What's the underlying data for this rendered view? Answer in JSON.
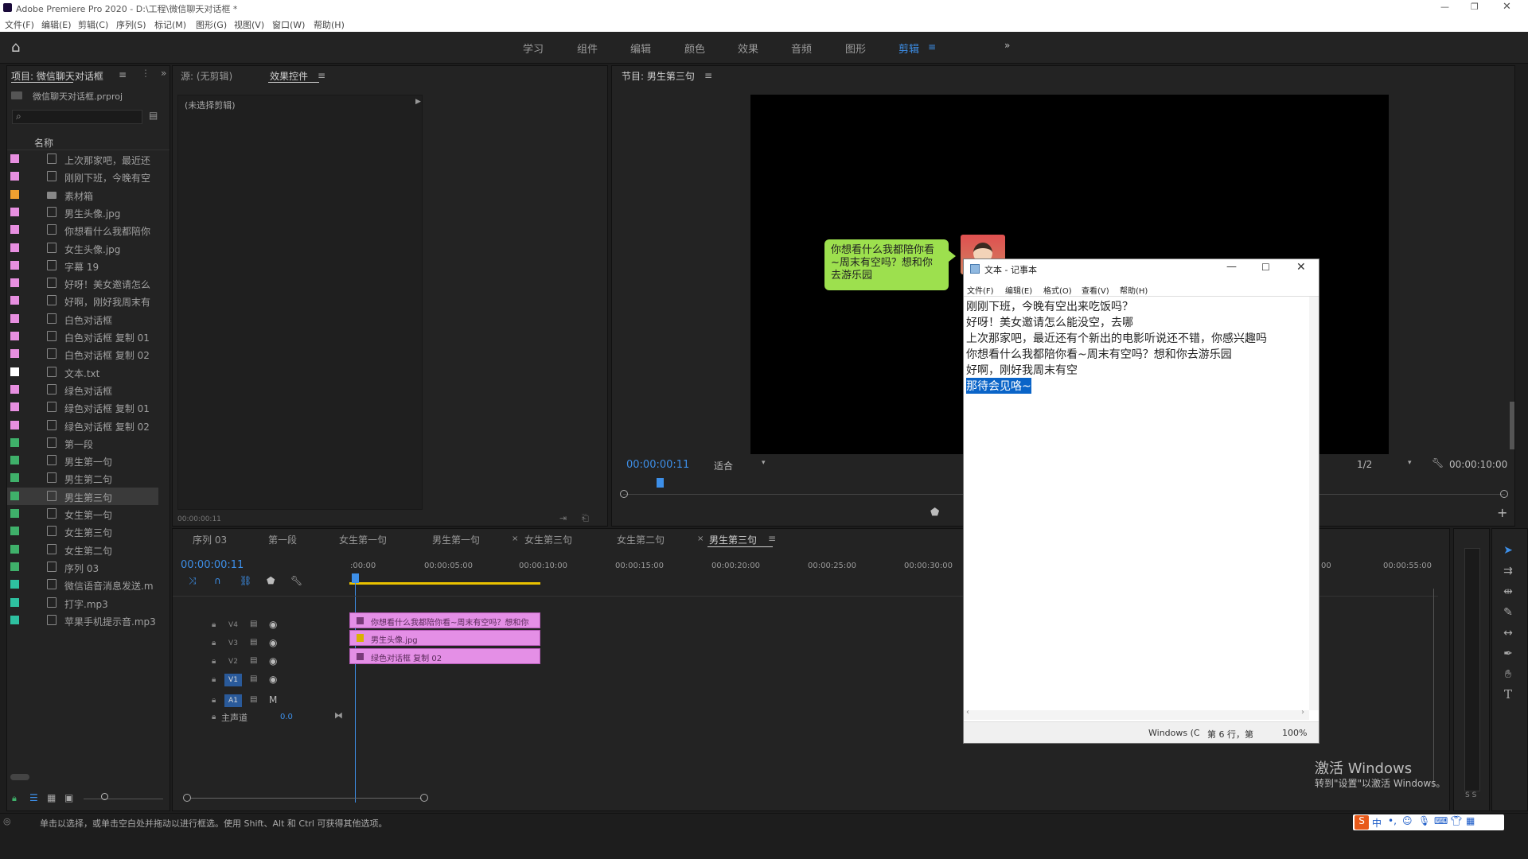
{
  "app": {
    "title": "Adobe Premiere Pro 2020 - D:\\工程\\微信聊天对话框 *",
    "menu": [
      "文件(F)",
      "编辑(E)",
      "剪辑(C)",
      "序列(S)",
      "标记(M)",
      "图形(G)",
      "视图(V)",
      "窗口(W)",
      "帮助(H)"
    ]
  },
  "workspaces": {
    "items": [
      "学习",
      "组件",
      "编辑",
      "颜色",
      "效果",
      "音频",
      "图形",
      "剪辑"
    ],
    "active": "剪辑"
  },
  "project": {
    "tab_label": "项目: 微信聊天对话框",
    "file": "微信聊天对话框.prproj",
    "column_name": "名称",
    "items": [
      {
        "label": "上次那家吧，最近还",
        "color": "#e78fe0"
      },
      {
        "label": "刚刚下班，今晚有空",
        "color": "#e78fe0"
      },
      {
        "label": "素材箱",
        "color": "#f0a030"
      },
      {
        "label": "男生头像.jpg",
        "color": "#e78fe0"
      },
      {
        "label": "你想看什么我都陪你",
        "color": "#e78fe0"
      },
      {
        "label": "女生头像.jpg",
        "color": "#e78fe0"
      },
      {
        "label": "字幕 19",
        "color": "#e78fe0"
      },
      {
        "label": "好呀！美女邀请怎么",
        "color": "#e78fe0"
      },
      {
        "label": "好啊，刚好我周末有",
        "color": "#e78fe0"
      },
      {
        "label": "白色对话框",
        "color": "#e78fe0"
      },
      {
        "label": "白色对话框 复制 01",
        "color": "#e78fe0"
      },
      {
        "label": "白色对话框 复制 02",
        "color": "#e78fe0"
      },
      {
        "label": "文本.txt",
        "color": "#ffffff"
      },
      {
        "label": "绿色对话框",
        "color": "#e78fe0"
      },
      {
        "label": "绿色对话框 复制 01",
        "color": "#e78fe0"
      },
      {
        "label": "绿色对话框 复制 02",
        "color": "#e78fe0"
      },
      {
        "label": "第一段",
        "color": "#3fb06a"
      },
      {
        "label": "男生第一句",
        "color": "#3fb06a"
      },
      {
        "label": "男生第二句",
        "color": "#3fb06a"
      },
      {
        "label": "男生第三句",
        "color": "#3fb06a"
      },
      {
        "label": "女生第一句",
        "color": "#3fb06a"
      },
      {
        "label": "女生第三句",
        "color": "#3fb06a"
      },
      {
        "label": "女生第二句",
        "color": "#3fb06a"
      },
      {
        "label": "序列 03",
        "color": "#3fb06a"
      },
      {
        "label": "微信语音消息发送.m",
        "color": "#2ec0a0"
      },
      {
        "label": "打字.mp3",
        "color": "#2ec0a0"
      },
      {
        "label": "苹果手机提示音.mp3",
        "color": "#2ec0a0"
      }
    ]
  },
  "source": {
    "tab_source": "源: (无剪辑)",
    "tab_effects": "效果控件",
    "no_clip": "(未选择剪辑)",
    "timecode": "00:00:00:11"
  },
  "program": {
    "tab_label": "节目: 男生第三句",
    "timecode": "00:00:00:11",
    "fit": "适合",
    "resolution": "1/2",
    "duration": "00:00:10:00",
    "bubble_text": "你想看什么我都陪你看~周末有空吗？想和你去游乐园"
  },
  "timeline": {
    "tabs": [
      "序列 03",
      "第一段",
      "女生第一句",
      "男生第一句",
      "女生第三句",
      "女生第二句",
      "男生第三句"
    ],
    "active_tab": "男生第三句",
    "timecode": "00:00:00:11",
    "ruler": [
      ":00:00",
      "00:00:05:00",
      "00:00:10:00",
      "00:00:15:00",
      "00:00:20:00",
      "00:00:25:00",
      "00:00:30:00",
      "00",
      "00:00:55:00"
    ],
    "tracks": [
      "V4",
      "V3",
      "V2",
      "V1",
      "A1"
    ],
    "master": "主声道",
    "master_value": "0.0",
    "clips": [
      "你想看什么我都陪你看~周末有空吗？想和你",
      "男生头像.jpg",
      "绿色对话框 复制 02"
    ]
  },
  "notepad": {
    "title": "文本 - 记事本",
    "menu": [
      "文件(F)",
      "编辑(E)",
      "格式(O)",
      "查看(V)",
      "帮助(H)"
    ],
    "lines": [
      "刚刚下班，今晚有空出来吃饭吗？",
      "好呀！美女邀请怎么能没空，去哪",
      "上次那家吧，最近还有个新出的电影听说还不错，你感兴趣吗",
      "你想看什么我都陪你看~周末有空吗？想和你去游乐园",
      "好啊，刚好我周末有空"
    ],
    "selected_line": "那待会见咯~",
    "status_encoding": "Windows (C",
    "status_pos": "第 6 行，第",
    "status_zoom": "100%"
  },
  "watermark": {
    "activate_title": "激活 Windows",
    "activate_sub": "转到\"设置\"以激活 Windows。"
  },
  "statusbar": {
    "hint": "单击以选择，或单击空白处并拖动以进行框选。使用 Shift、Alt 和 Ctrl 可获得其他选项。"
  },
  "audio_meter": {
    "labels": "S S"
  },
  "ime": {
    "label": "中"
  }
}
